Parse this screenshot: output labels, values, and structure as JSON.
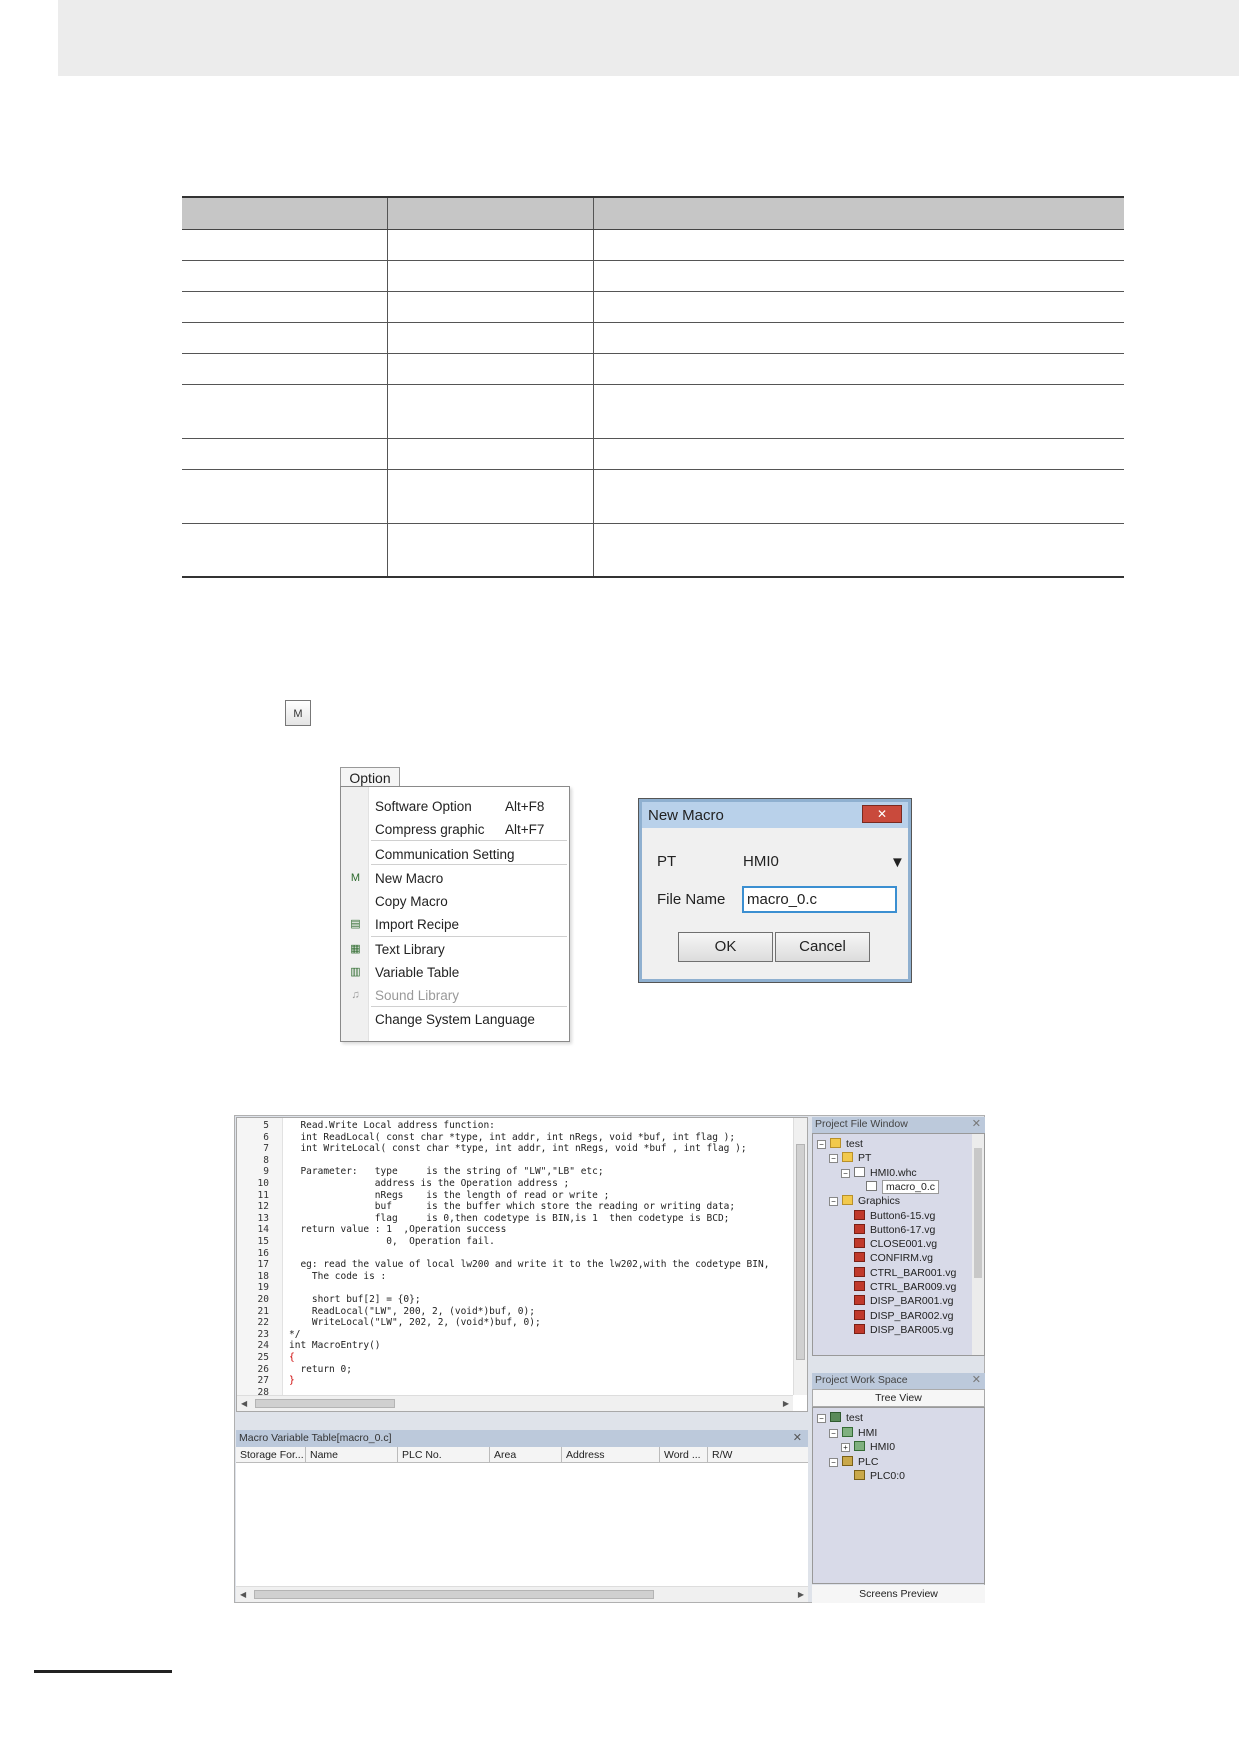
{
  "menu": {
    "tab": "Option",
    "items": [
      {
        "label": "Software Option",
        "shortcut": "Alt+F8",
        "icon": ""
      },
      {
        "label": "Compress graphic",
        "shortcut": "Alt+F7",
        "icon": ""
      },
      {
        "label": "Communication Setting",
        "shortcut": "",
        "icon": ""
      },
      {
        "label": "New Macro",
        "shortcut": "",
        "icon": "new-macro-icon"
      },
      {
        "label": "Copy Macro",
        "shortcut": "",
        "icon": ""
      },
      {
        "label": "Import Recipe",
        "shortcut": "",
        "icon": "import-recipe-icon"
      },
      {
        "label": "Text Library",
        "shortcut": "",
        "icon": "text-library-icon"
      },
      {
        "label": "Variable Table",
        "shortcut": "",
        "icon": "variable-table-icon"
      },
      {
        "label": "Sound Library",
        "shortcut": "",
        "icon": "sound-library-icon",
        "disabled": true
      },
      {
        "label": "Change System Language",
        "shortcut": "",
        "icon": ""
      }
    ]
  },
  "dialog": {
    "title": "New Macro",
    "pt_label": "PT",
    "pt_value": "HMI0",
    "filename_label": "File Name",
    "filename_value": "macro_0.c",
    "ok": "OK",
    "cancel": "Cancel"
  },
  "editor": {
    "lines": [
      {
        "n": "5",
        "t": "  Read.Write Local address function:"
      },
      {
        "n": "6",
        "t": "  int ReadLocal( const char *type, int addr, int nRegs, void *buf, int flag );"
      },
      {
        "n": "7",
        "t": "  int WriteLocal( const char *type, int addr, int nRegs, void *buf , int flag );"
      },
      {
        "n": "8",
        "t": ""
      },
      {
        "n": "9",
        "t": "  Parameter:   type     is the string of \"LW\",\"LB\" etc;"
      },
      {
        "n": "10",
        "t": "               address is the Operation address ;"
      },
      {
        "n": "11",
        "t": "               nRegs    is the length of read or write ;"
      },
      {
        "n": "12",
        "t": "               buf      is the buffer which store the reading or writing data;"
      },
      {
        "n": "13",
        "t": "               flag     is 0,then codetype is BIN,is 1  then codetype is BCD;"
      },
      {
        "n": "14",
        "t": "  return value : 1  ,Operation success"
      },
      {
        "n": "15",
        "t": "                 0,  Operation fail."
      },
      {
        "n": "16",
        "t": ""
      },
      {
        "n": "17",
        "t": "  eg: read the value of local lw200 and write it to the lw202,with the codetype BIN,"
      },
      {
        "n": "18",
        "t": "    The code is :"
      },
      {
        "n": "19",
        "t": ""
      },
      {
        "n": "20",
        "t": "    short buf[2] = {0};"
      },
      {
        "n": "21",
        "t": "    ReadLocal(\"LW\", 200, 2, (void*)buf, 0);"
      },
      {
        "n": "22",
        "t": "    WriteLocal(\"LW\", 202, 2, (void*)buf, 0);"
      },
      {
        "n": "23",
        "t": "*/"
      },
      {
        "n": "24",
        "t": "int MacroEntry()"
      },
      {
        "n": "25",
        "t": "{",
        "brace": true
      },
      {
        "n": "26",
        "t": "  return 0;"
      },
      {
        "n": "27",
        "t": "}",
        "brace": true
      },
      {
        "n": "28",
        "t": ""
      }
    ]
  },
  "var_table": {
    "title": "Macro Variable Table[macro_0.c]",
    "columns": [
      "Storage For...",
      "Name",
      "PLC No.",
      "Area",
      "Address",
      "Word ...",
      "R/W"
    ]
  },
  "project_file": {
    "title": "Project File Window",
    "items": [
      {
        "label": "test",
        "icon": "folder",
        "level": 0,
        "pm": "-"
      },
      {
        "label": "PT",
        "icon": "folder",
        "level": 1,
        "pm": "-"
      },
      {
        "label": "HMI0.whc",
        "icon": "file",
        "level": 2,
        "pm": "-"
      },
      {
        "label": "macro_0.c",
        "icon": "file",
        "level": 3,
        "pm": "",
        "selected": true
      },
      {
        "label": "Graphics",
        "icon": "folder",
        "level": 1,
        "pm": "-"
      },
      {
        "label": "Button6-15.vg",
        "icon": "img",
        "level": 2,
        "pm": ""
      },
      {
        "label": "Button6-17.vg",
        "icon": "img",
        "level": 2,
        "pm": ""
      },
      {
        "label": "CLOSE001.vg",
        "icon": "img",
        "level": 2,
        "pm": ""
      },
      {
        "label": "CONFIRM.vg",
        "icon": "img",
        "level": 2,
        "pm": ""
      },
      {
        "label": "CTRL_BAR001.vg",
        "icon": "img",
        "level": 2,
        "pm": ""
      },
      {
        "label": "CTRL_BAR009.vg",
        "icon": "img",
        "level": 2,
        "pm": ""
      },
      {
        "label": "DISP_BAR001.vg",
        "icon": "img",
        "level": 2,
        "pm": ""
      },
      {
        "label": "DISP_BAR002.vg",
        "icon": "img",
        "level": 2,
        "pm": ""
      },
      {
        "label": "DISP_BAR005.vg",
        "icon": "img",
        "level": 2,
        "pm": ""
      }
    ]
  },
  "project_workspace": {
    "title": "Project Work Space",
    "tab": "Tree View",
    "bottom_tab": "Screens Preview",
    "items": [
      {
        "label": "test",
        "icon": "root",
        "level": 0,
        "pm": "-"
      },
      {
        "label": "HMI",
        "icon": "hmi",
        "level": 1,
        "pm": "-"
      },
      {
        "label": "HMI0",
        "icon": "hmi",
        "level": 2,
        "pm": "+"
      },
      {
        "label": "PLC",
        "icon": "plc",
        "level": 1,
        "pm": "-"
      },
      {
        "label": "PLC0:0",
        "icon": "plc",
        "level": 2,
        "pm": ""
      }
    ]
  }
}
